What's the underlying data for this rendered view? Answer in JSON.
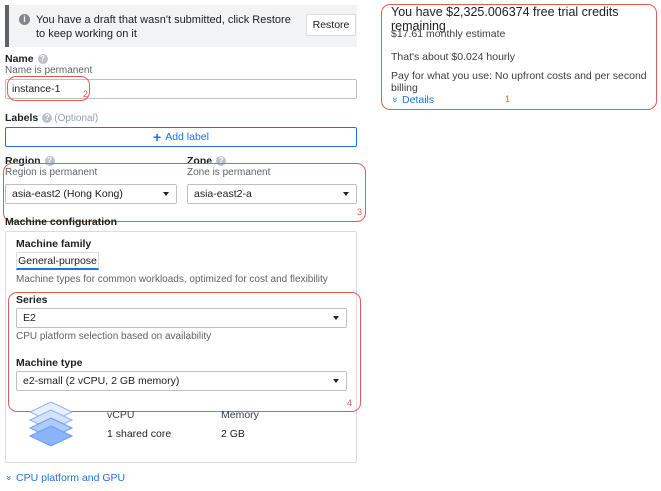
{
  "draft": {
    "message": "You have a draft that wasn't submitted, click Restore to keep working on it",
    "restore_label": "Restore"
  },
  "name": {
    "label": "Name",
    "hint": "Name is permanent",
    "value": "instance-1"
  },
  "labels": {
    "label": "Labels",
    "optional": "(Optional)",
    "add_label": "Add label"
  },
  "region": {
    "label": "Region",
    "hint": "Region is permanent",
    "value": "asia-east2 (Hong Kong)"
  },
  "zone": {
    "label": "Zone",
    "hint": "Zone is permanent",
    "value": "asia-east2-a"
  },
  "machine_config": {
    "title": "Machine configuration",
    "family_label": "Machine family",
    "family_value": "General-purpose",
    "family_desc": "Machine types for common workloads, optimized for cost and flexibility",
    "series_label": "Series",
    "series_value": "E2",
    "series_hint": "CPU platform selection based on availability",
    "type_label": "Machine type",
    "type_value": "e2-small (2 vCPU, 2 GB memory)",
    "vcpu_header": "vCPU",
    "memory_header": "Memory",
    "vcpu_value": "1 shared core",
    "memory_value": "2 GB"
  },
  "cpu_platform_link": "CPU platform and GPU",
  "credits": {
    "title": "You have $2,325.006374 free trial credits remaining",
    "monthly": "$17.61 monthly estimate",
    "hourly": "That's about $0.024 hourly",
    "pay_note": "Pay for what you use: No upfront costs and per second billing",
    "details": "Details"
  },
  "annotations": {
    "n1": "1",
    "n2": "2",
    "n3": "3",
    "n4": "4"
  },
  "colors": {
    "accent": "#1a73e8",
    "annotation": "#e25c5c"
  }
}
